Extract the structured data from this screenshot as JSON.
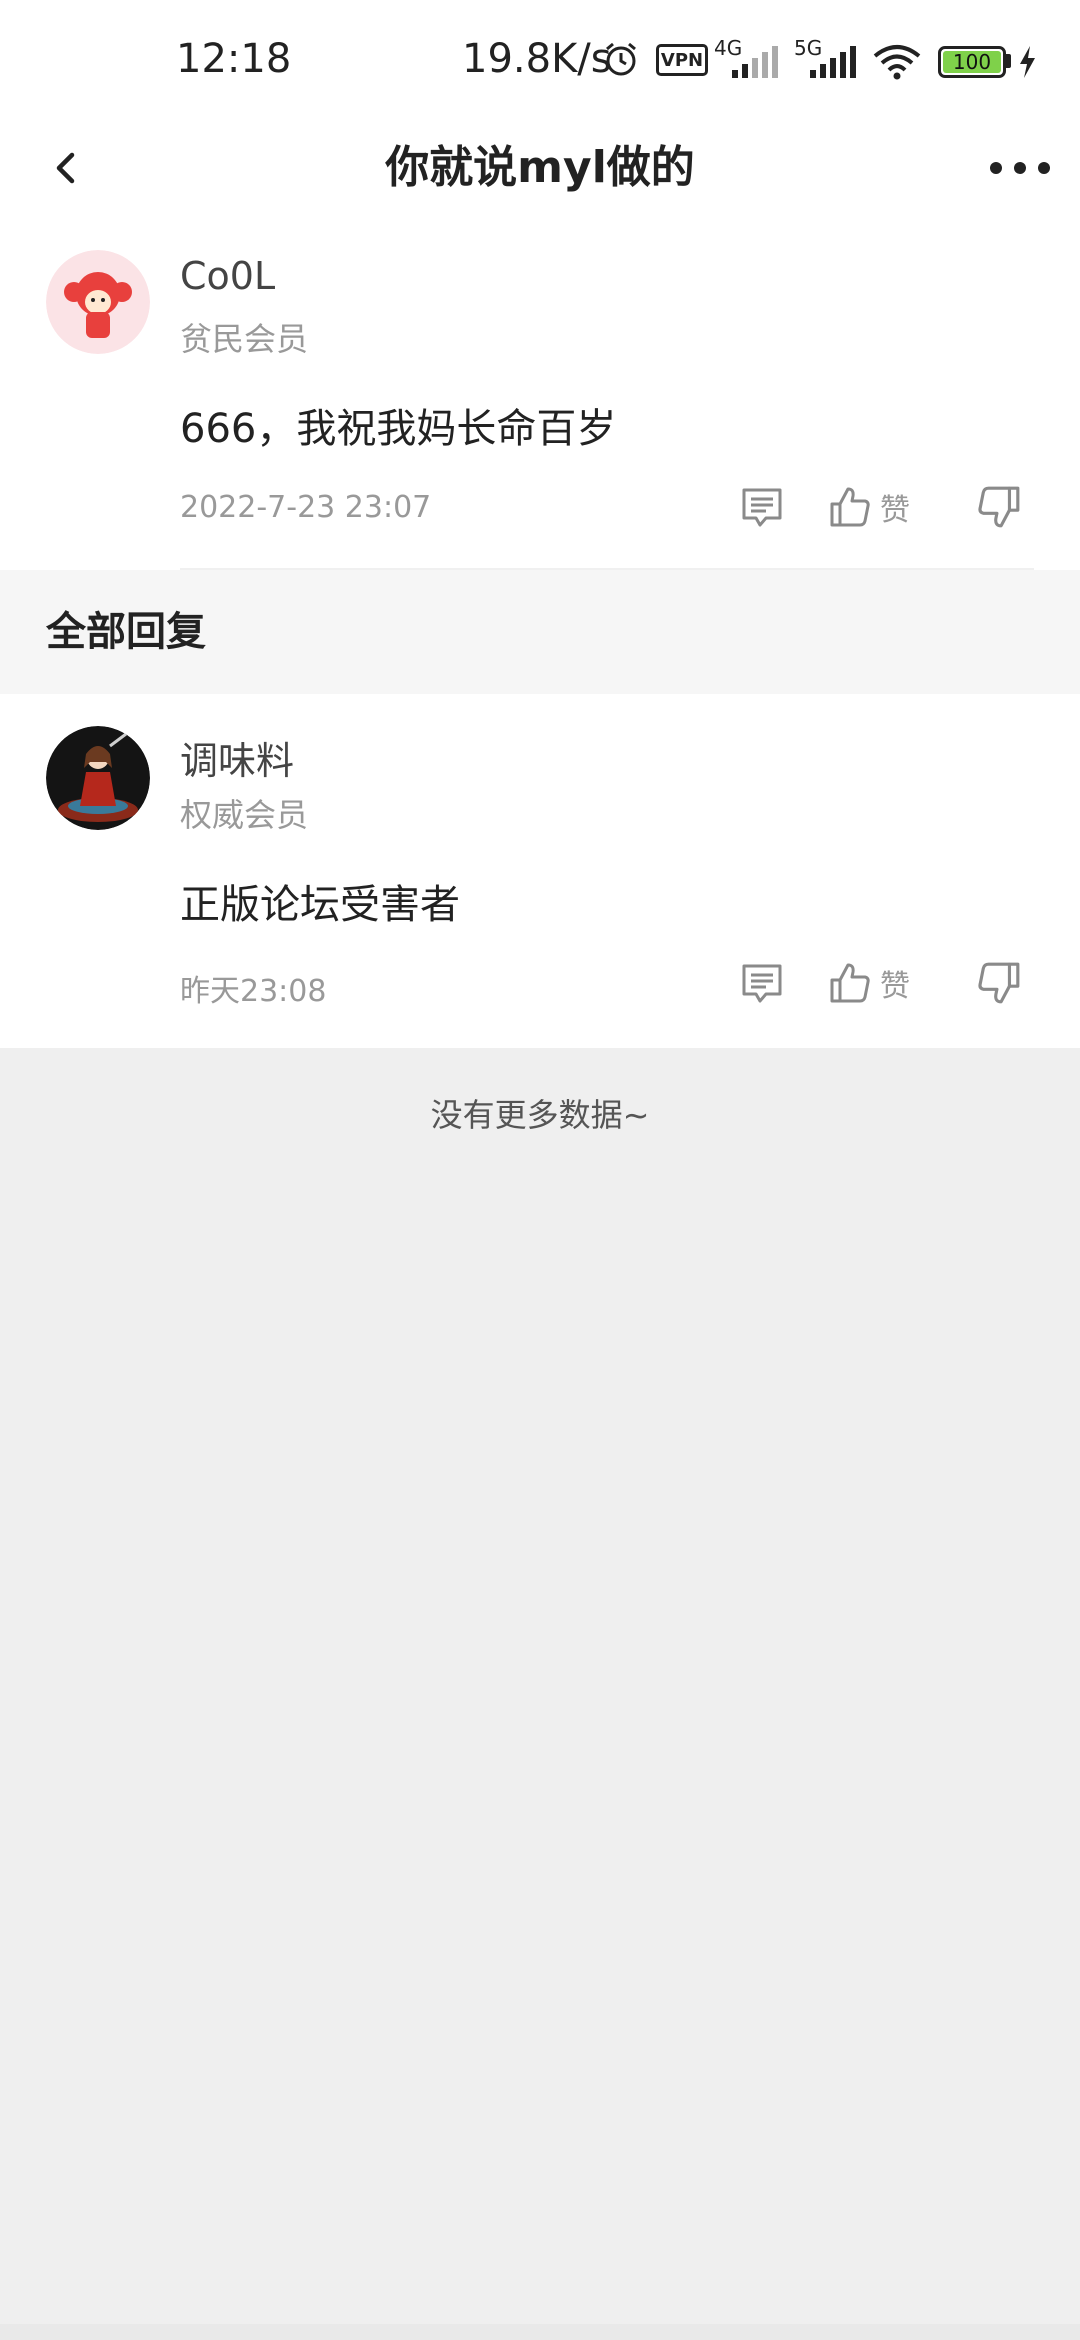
{
  "status_bar": {
    "time": "12:18",
    "net_speed": "19.8K/s",
    "vpn_label": "VPN",
    "net1_label": "4G",
    "net2_label": "5G",
    "battery_level": "100"
  },
  "header": {
    "title": "你就说myl做的"
  },
  "main_post": {
    "username": "Co0L",
    "member_level": "贫民会员",
    "content": "666，我祝我妈长命百岁",
    "timestamp": "2022-7-23 23:07",
    "like_label": "赞"
  },
  "replies_section": {
    "title": "全部回复"
  },
  "replies": [
    {
      "username": "调味料",
      "member_level": "权威会员",
      "content": "正版论坛受害者",
      "timestamp": "昨天23:08",
      "like_label": "赞"
    }
  ],
  "footer": {
    "no_more_text": "没有更多数据~"
  },
  "colors": {
    "accent_battery": "#7fd14a",
    "muted_text": "#999999",
    "page_bg": "#efefef"
  },
  "icons": {
    "back": "chevron-left-icon",
    "more": "more-dots-icon",
    "comment": "comment-icon",
    "like": "thumbs-up-icon",
    "dislike": "thumbs-down-icon"
  }
}
